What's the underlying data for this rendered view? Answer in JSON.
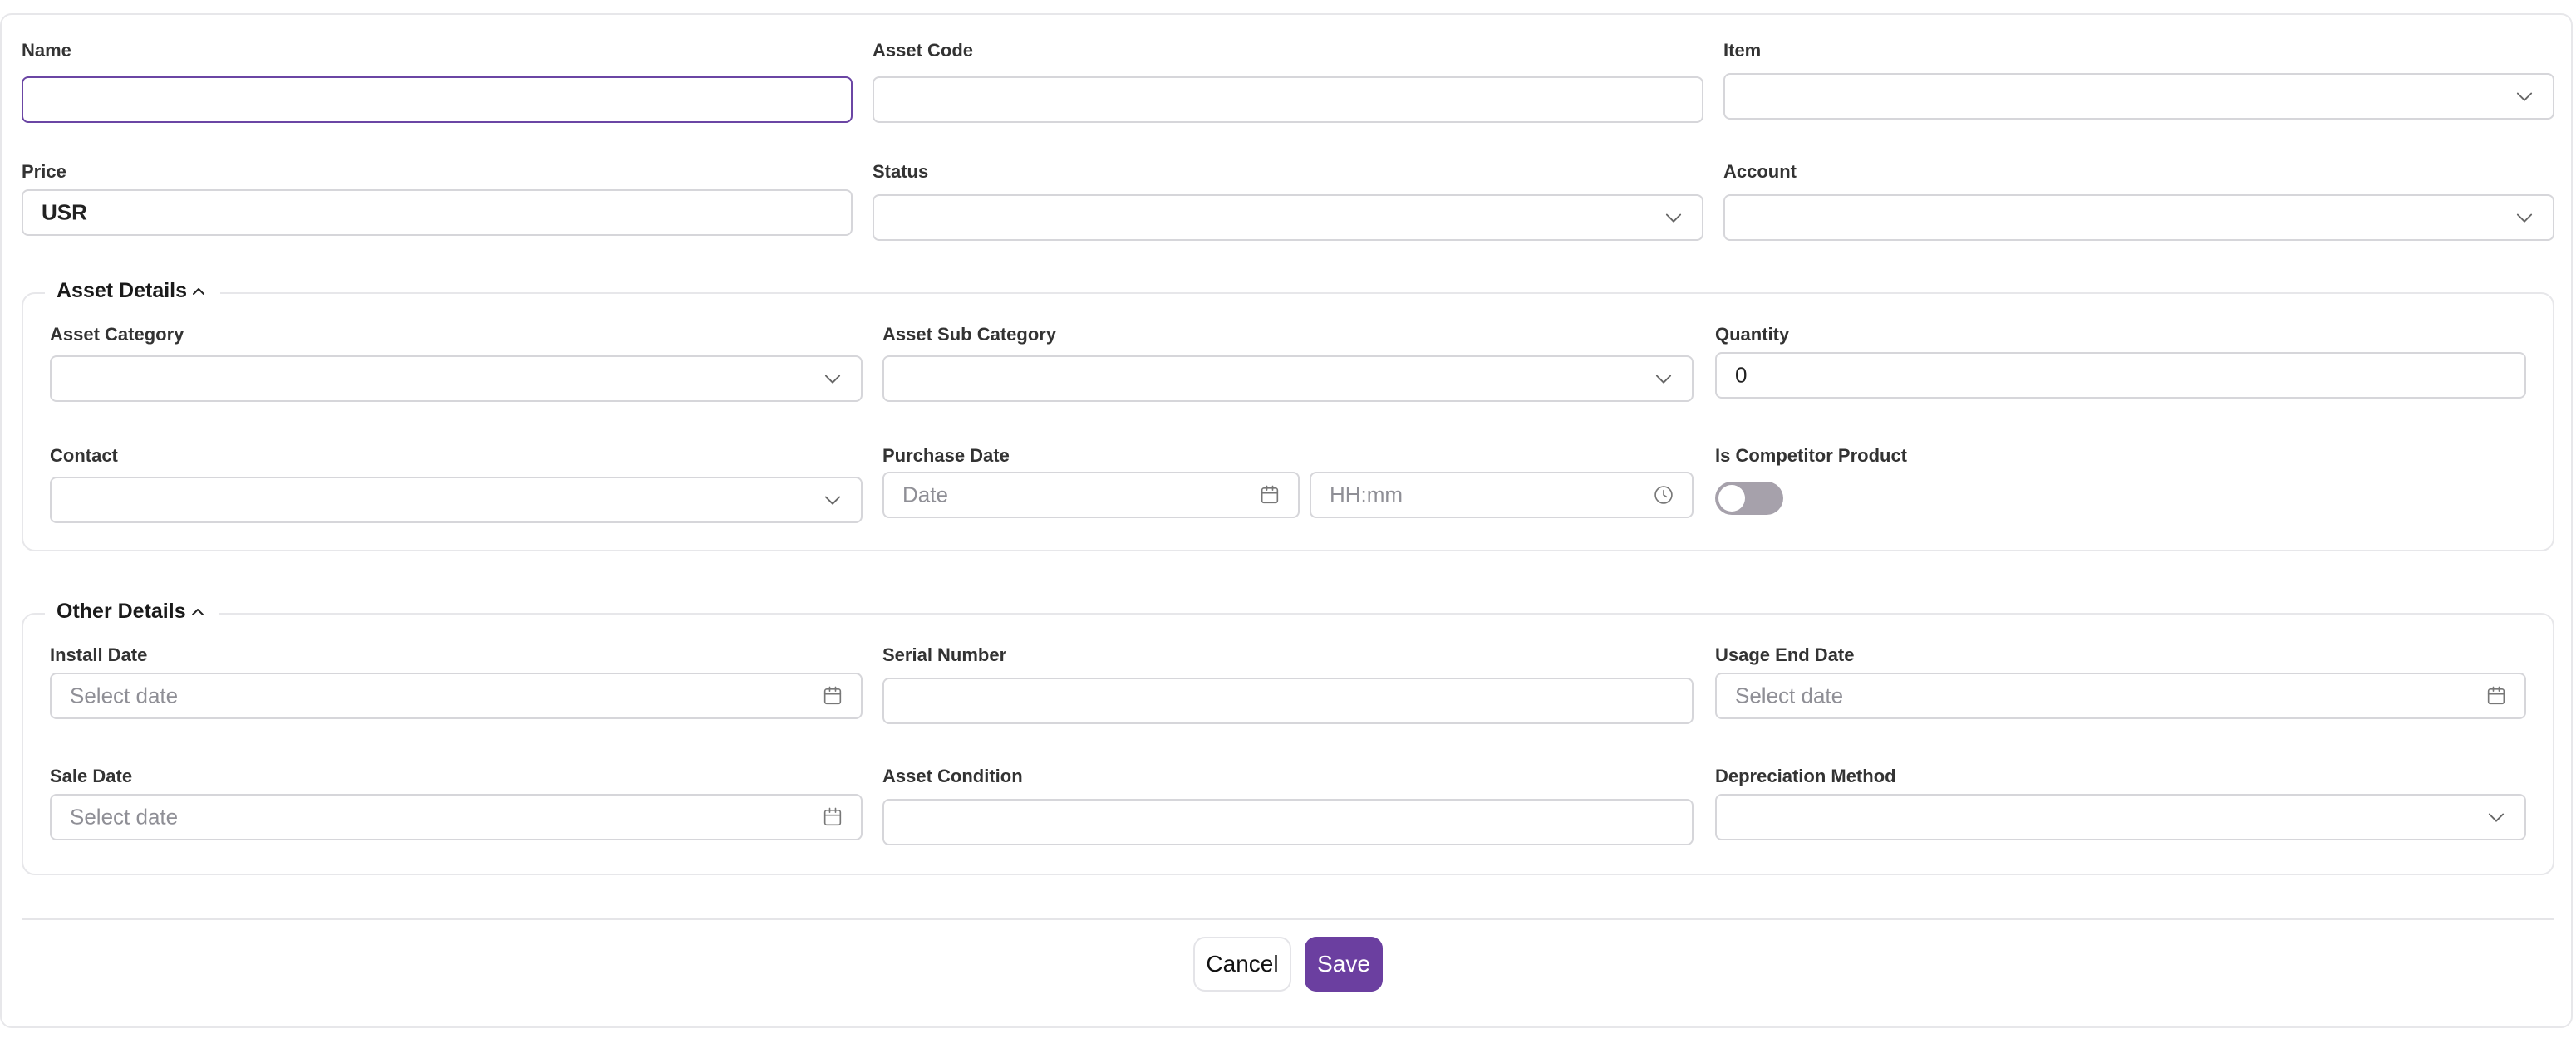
{
  "form": {
    "name": {
      "label": "Name",
      "value": ""
    },
    "asset_code": {
      "label": "Asset Code",
      "value": ""
    },
    "item": {
      "label": "Item",
      "value": ""
    },
    "price": {
      "label": "Price",
      "value": "USR"
    },
    "status": {
      "label": "Status",
      "value": ""
    },
    "account": {
      "label": "Account",
      "value": ""
    }
  },
  "asset_details": {
    "title": "Asset Details",
    "asset_category": {
      "label": "Asset Category",
      "value": ""
    },
    "asset_sub_category": {
      "label": "Asset Sub Category",
      "value": ""
    },
    "quantity": {
      "label": "Quantity",
      "value": "0"
    },
    "contact": {
      "label": "Contact",
      "value": ""
    },
    "purchase_date": {
      "label": "Purchase Date",
      "date_placeholder": "Date",
      "time_placeholder": "HH:mm"
    },
    "is_competitor_product": {
      "label": "Is Competitor Product",
      "checked": false
    }
  },
  "other_details": {
    "title": "Other Details",
    "install_date": {
      "label": "Install Date",
      "placeholder": "Select date"
    },
    "serial_number": {
      "label": "Serial Number",
      "value": ""
    },
    "usage_end_date": {
      "label": "Usage End Date",
      "placeholder": "Select date"
    },
    "sale_date": {
      "label": "Sale Date",
      "placeholder": "Select date"
    },
    "asset_condition": {
      "label": "Asset Condition",
      "value": ""
    },
    "depreciation_method": {
      "label": "Depreciation Method",
      "value": ""
    }
  },
  "actions": {
    "cancel": "Cancel",
    "save": "Save"
  },
  "colors": {
    "accent": "#6b3fa0",
    "focus_border": "#6b46a4",
    "toggle_off": "#a6a1ab"
  }
}
